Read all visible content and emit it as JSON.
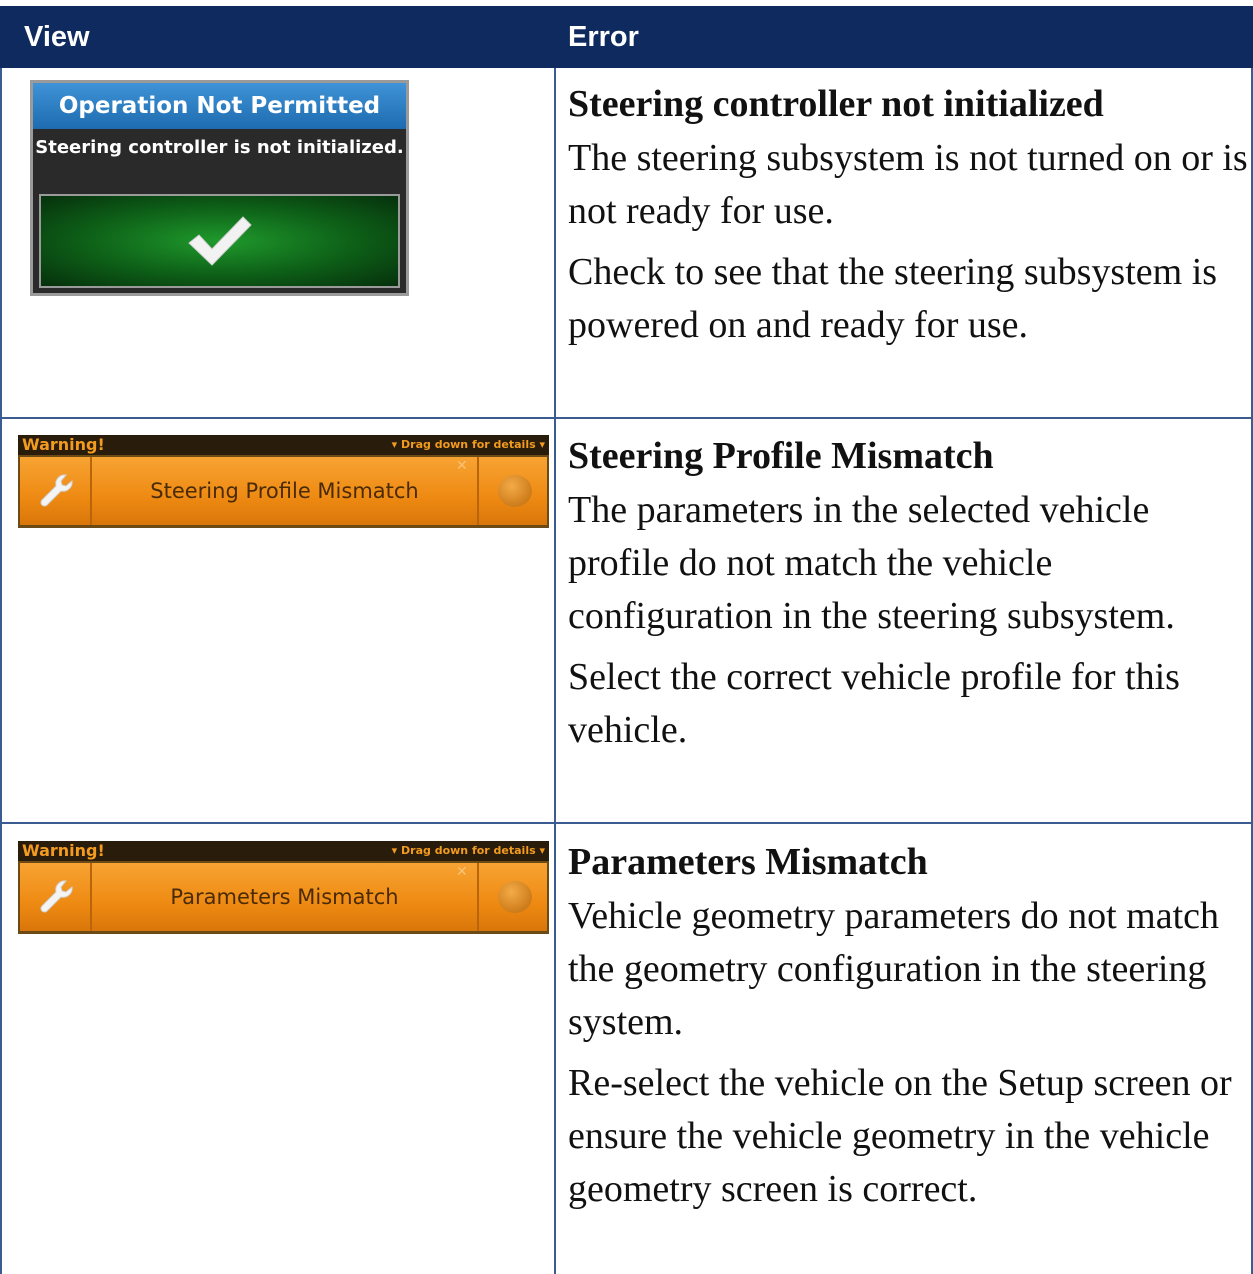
{
  "header": {
    "view": "View",
    "error": "Error"
  },
  "rows": [
    {
      "view": {
        "dialog_title": "Operation Not Permitted",
        "dialog_message": "Steering controller is not initialized.",
        "ok_icon": "checkmark-icon"
      },
      "error": {
        "title": "Steering controller not initialized",
        "description": "The steering subsystem is not turned on or is not ready for use.",
        "action": "Check to see that the steering subsystem is powered on and ready for use."
      }
    },
    {
      "view": {
        "warning_title": "Warning!",
        "drag_hint": "▾ Drag down for details ▾",
        "message": "Steering Profile Mismatch",
        "icon": "wrench-icon"
      },
      "error": {
        "title": "Steering Profile Mismatch",
        "description": "The parameters in the selected vehicle profile do not match the vehicle configuration in the steering subsystem.",
        "action": "Select the correct vehicle profile for this vehicle."
      }
    },
    {
      "view": {
        "warning_title": "Warning!",
        "drag_hint": "▾ Drag down for details ▾",
        "message": "Parameters Mismatch",
        "icon": "wrench-icon"
      },
      "error": {
        "title": "Parameters Mismatch",
        "description": "Vehicle geometry parameters do not match the geometry configuration in the steering system.",
        "action": "Re-select the vehicle on the Setup screen or ensure the vehicle geometry in the vehicle geometry screen is correct."
      }
    }
  ],
  "colors": {
    "header_bg": "#0f2a5e",
    "border": "#3a5c91",
    "warning_orange": "#ee8a12",
    "dialog_blue": "#1e6bb0"
  }
}
